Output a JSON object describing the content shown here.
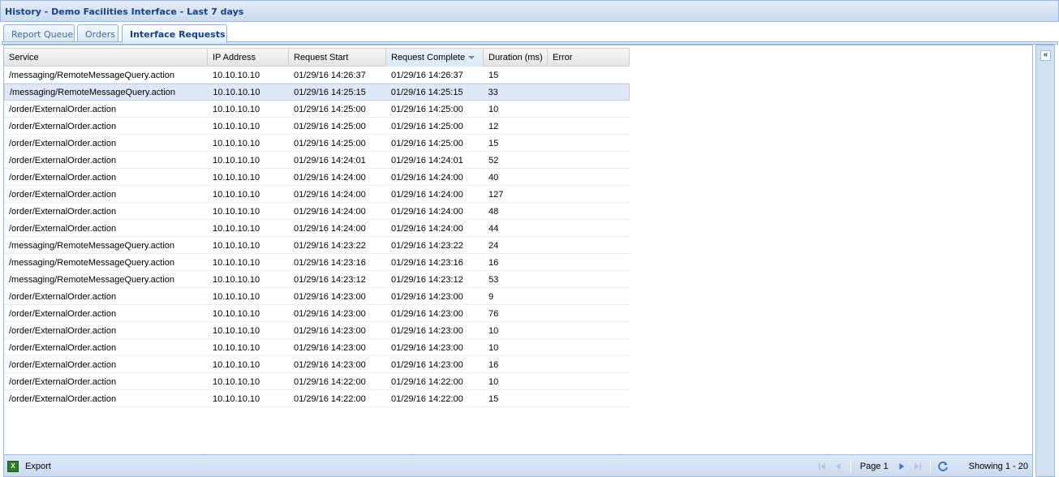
{
  "window": {
    "title": "History - Demo Facilities Interface - Last 7 days"
  },
  "tabs": [
    {
      "label": "Report Queue",
      "active": false
    },
    {
      "label": "Orders",
      "active": false
    },
    {
      "label": "Interface Requests",
      "active": true
    }
  ],
  "grid": {
    "columns": [
      "Service",
      "IP Address",
      "Request Start",
      "Request Complete",
      "Duration (ms)",
      "Error"
    ],
    "sorted_column": "Request Complete",
    "sort_direction": "descending",
    "selected_row": 1,
    "rows": [
      [
        "/messaging/RemoteMessageQuery.action",
        "10.10.10.10",
        "01/29/16 14:26:37",
        "01/29/16 14:26:37",
        "15",
        ""
      ],
      [
        "/messaging/RemoteMessageQuery.action",
        "10.10.10.10",
        "01/29/16 14:25:15",
        "01/29/16 14:25:15",
        "33",
        ""
      ],
      [
        "/order/ExternalOrder.action",
        "10.10.10.10",
        "01/29/16 14:25:00",
        "01/29/16 14:25:00",
        "10",
        ""
      ],
      [
        "/order/ExternalOrder.action",
        "10.10.10.10",
        "01/29/16 14:25:00",
        "01/29/16 14:25:00",
        "12",
        ""
      ],
      [
        "/order/ExternalOrder.action",
        "10.10.10.10",
        "01/29/16 14:25:00",
        "01/29/16 14:25:00",
        "15",
        ""
      ],
      [
        "/order/ExternalOrder.action",
        "10.10.10.10",
        "01/29/16 14:24:01",
        "01/29/16 14:24:01",
        "52",
        ""
      ],
      [
        "/order/ExternalOrder.action",
        "10.10.10.10",
        "01/29/16 14:24:00",
        "01/29/16 14:24:00",
        "40",
        ""
      ],
      [
        "/order/ExternalOrder.action",
        "10.10.10.10",
        "01/29/16 14:24:00",
        "01/29/16 14:24:00",
        "127",
        ""
      ],
      [
        "/order/ExternalOrder.action",
        "10.10.10.10",
        "01/29/16 14:24:00",
        "01/29/16 14:24:00",
        "48",
        ""
      ],
      [
        "/order/ExternalOrder.action",
        "10.10.10.10",
        "01/29/16 14:24:00",
        "01/29/16 14:24:00",
        "44",
        ""
      ],
      [
        "/messaging/RemoteMessageQuery.action",
        "10.10.10.10",
        "01/29/16 14:23:22",
        "01/29/16 14:23:22",
        "24",
        ""
      ],
      [
        "/messaging/RemoteMessageQuery.action",
        "10.10.10.10",
        "01/29/16 14:23:16",
        "01/29/16 14:23:16",
        "16",
        ""
      ],
      [
        "/messaging/RemoteMessageQuery.action",
        "10.10.10.10",
        "01/29/16 14:23:12",
        "01/29/16 14:23:12",
        "53",
        ""
      ],
      [
        "/order/ExternalOrder.action",
        "10.10.10.10",
        "01/29/16 14:23:00",
        "01/29/16 14:23:00",
        "9",
        ""
      ],
      [
        "/order/ExternalOrder.action",
        "10.10.10.10",
        "01/29/16 14:23:00",
        "01/29/16 14:23:00",
        "76",
        ""
      ],
      [
        "/order/ExternalOrder.action",
        "10.10.10.10",
        "01/29/16 14:23:00",
        "01/29/16 14:23:00",
        "10",
        ""
      ],
      [
        "/order/ExternalOrder.action",
        "10.10.10.10",
        "01/29/16 14:23:00",
        "01/29/16 14:23:00",
        "10",
        ""
      ],
      [
        "/order/ExternalOrder.action",
        "10.10.10.10",
        "01/29/16 14:23:00",
        "01/29/16 14:23:00",
        "16",
        ""
      ],
      [
        "/order/ExternalOrder.action",
        "10.10.10.10",
        "01/29/16 14:22:00",
        "01/29/16 14:22:00",
        "10",
        ""
      ],
      [
        "/order/ExternalOrder.action",
        "10.10.10.10",
        "01/29/16 14:22:00",
        "01/29/16 14:22:00",
        "15",
        ""
      ]
    ]
  },
  "toolbar": {
    "export_label": "Export",
    "export_icon": "excel-icon",
    "page_label": "Page 1",
    "showing_label": "Showing 1 - 20"
  },
  "east_panel": {
    "collapse_icon": "double-chevron-left-icon"
  },
  "colors": {
    "title_text": "#15428b",
    "border": "#99bbe8",
    "selected_row": "#dfe8f6",
    "excel_green": "#2d7d2d"
  }
}
